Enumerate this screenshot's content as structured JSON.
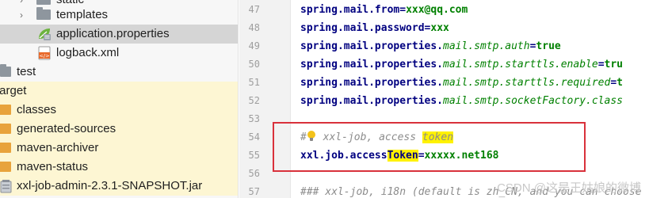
{
  "tree": {
    "items": [
      {
        "label": "static",
        "kind": "folder-grey",
        "expand": "›"
      },
      {
        "label": "templates",
        "kind": "folder-grey",
        "expand": "›"
      },
      {
        "label": "application.properties",
        "kind": "spring-icon"
      },
      {
        "label": "logback.xml",
        "kind": "xml-icon"
      },
      {
        "label": "test",
        "kind": "folder-grey"
      },
      {
        "label": "target",
        "kind": "folder-orange"
      },
      {
        "label": "classes",
        "kind": "folder-orange"
      },
      {
        "label": "generated-sources",
        "kind": "folder-orange"
      },
      {
        "label": "maven-archiver",
        "kind": "folder-orange"
      },
      {
        "label": "maven-status",
        "kind": "folder-orange"
      },
      {
        "label": "xxl-job-admin-2.3.1-SNAPSHOT.jar",
        "kind": "jar-icon"
      }
    ]
  },
  "editor": {
    "line_numbers": [
      "47",
      "48",
      "49",
      "50",
      "51",
      "52",
      "53",
      "54",
      "55",
      "56",
      "57"
    ],
    "lines": {
      "l47": {
        "key": "spring.mail.from",
        "eq": "=",
        "val": "xxx@qq.com"
      },
      "l48": {
        "key": "spring.mail.password",
        "eq": "=",
        "val": "xxx"
      },
      "l49": {
        "key": "spring.mail.properties.",
        "ikey": "mail.smtp.auth",
        "eq": "=",
        "val": "true"
      },
      "l50": {
        "key": "spring.mail.properties.",
        "ikey": "mail.smtp.starttls.enable",
        "eq": "=",
        "val": "tru"
      },
      "l51": {
        "key": "spring.mail.properties.",
        "ikey": "mail.smtp.starttls.required",
        "eq": "=",
        "val": "t"
      },
      "l52": {
        "key": "spring.mail.properties.",
        "ikey": "mail.smtp.socketFactory.class"
      },
      "l54": {
        "hash": "#",
        "text": " xxl-job, access ",
        "highlight": "token"
      },
      "l55": {
        "key_a": "xxl.job.access",
        "key_hl": "Token",
        "eq": "=",
        "val": "xxxxx.net168"
      },
      "l57": {
        "text": "### xxl-job, i18n (default is zh_CN, and you can choose"
      }
    },
    "watermark": "CSDN @这是王姑娘的微博"
  },
  "colors": {
    "highlight": "#fff200",
    "annotation_box": "#d9313b",
    "key": "#000080",
    "value": "#008000",
    "comment": "#8c8c8c"
  }
}
